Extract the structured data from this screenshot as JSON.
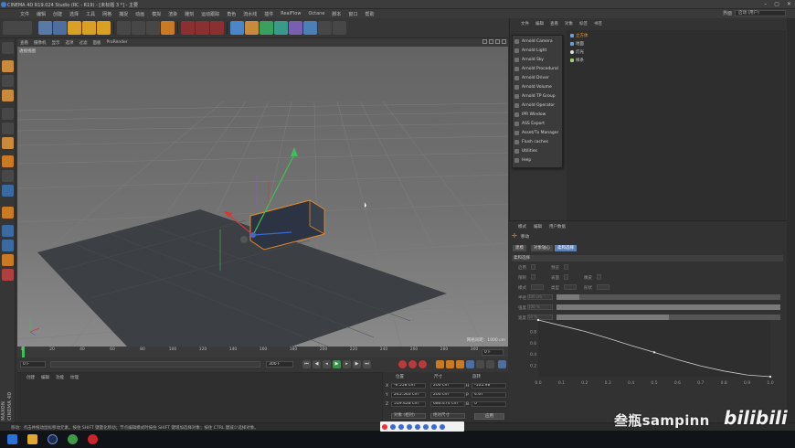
{
  "window": {
    "title": "CINEMA 4D R19.024 Studio (RC - R19) - [未标题 3 *] - 主要"
  },
  "menu": [
    "文件",
    "编辑",
    "创建",
    "选择",
    "工具",
    "网格",
    "捕捉",
    "动画",
    "模拟",
    "渲染",
    "雕刻",
    "运动跟踪",
    "角色",
    "流水线",
    "插件",
    "RealFlow",
    "Octane",
    "脚本",
    "窗口",
    "帮助"
  ],
  "layout": {
    "label": "界面",
    "value": "启动 (用户)"
  },
  "viewport": {
    "menu": [
      "查看",
      "摄像机",
      "显示",
      "选项",
      "过滤",
      "面板",
      "ProRender"
    ],
    "label": "透视视图",
    "grid_spacing": "网格间距：1000 cm"
  },
  "timeline": {
    "ticks": [
      "0",
      "20",
      "40",
      "60",
      "80",
      "100",
      "120",
      "140",
      "160",
      "180",
      "200",
      "220",
      "240",
      "260",
      "280",
      "300"
    ],
    "current_frame": "0 F",
    "start_frame": "0 F",
    "end_frame": "300 F",
    "min_frame": "0 F",
    "max_frame": "300 F"
  },
  "material_panel": {
    "menu": [
      "创建",
      "编辑",
      "功能",
      "纹理"
    ]
  },
  "coordinates": {
    "headers": [
      "位置",
      "尺寸",
      "旋转"
    ],
    "rows": [
      {
        "axis": "X",
        "pos": "-6.558 cm",
        "size": "200 cm",
        "rot_axis": "H",
        "rot": "-105.98 °"
      },
      {
        "axis": "Y",
        "pos": "245.563 cm",
        "size": "200 cm",
        "rot_axis": "P",
        "rot": "4.67 °"
      },
      {
        "axis": "Z",
        "pos": "519.428 cm",
        "size": "686.474 cm",
        "rot_axis": "B",
        "rot": "0 °"
      }
    ],
    "mode_select": "对象 (相对)",
    "size_select": "绝对尺寸",
    "apply_label": "应用"
  },
  "object_manager": {
    "tabs": [
      "文件",
      "编辑",
      "查看",
      "对象",
      "标签",
      "书签"
    ],
    "objects": [
      {
        "name": "立方体",
        "selected": true
      },
      {
        "name": "地面",
        "selected": false
      },
      {
        "name": "灯光",
        "selected": false
      },
      {
        "name": "样条",
        "selected": false
      }
    ]
  },
  "arnold_menu": {
    "items": [
      "Arnold Camera",
      "Arnold Light",
      "Arnold Sky",
      "Arnold Procedural",
      "Arnold Driver",
      "Arnold Volume",
      "Arnold TP Group",
      "Arnold Operator",
      "IPR Window",
      "ASS Export",
      "Asset/Tx Manager",
      "Flush caches",
      "Utilities",
      "Help"
    ]
  },
  "attributes": {
    "tabs": [
      "模式",
      "编辑",
      "用户数据"
    ],
    "object_name": "移动",
    "sub_tabs": [
      "建模",
      "对象轴心",
      "柔和选择"
    ],
    "section": "柔和选择",
    "props": [
      {
        "label": "启用",
        "value": "",
        "row": 0,
        "col": 0
      },
      {
        "label": "限制",
        "value": "",
        "row": 1,
        "col": 0
      },
      {
        "label": "模式",
        "value": "",
        "row": 2,
        "col": 0
      },
      {
        "label": "半径",
        "value": "100 cm",
        "row": 3,
        "col": 0
      },
      {
        "label": "强度",
        "value": "100 %",
        "row": 4,
        "col": 0
      },
      {
        "label": "宽度",
        "value": "50 %",
        "row": 5,
        "col": 0
      },
      {
        "label": "预览",
        "value": "",
        "row": 0,
        "col": 1
      },
      {
        "label": "表面",
        "value": "",
        "row": 1,
        "col": 1
      },
      {
        "label": "类型",
        "value": "",
        "row": 2,
        "col": 1
      },
      {
        "label": "橡皮",
        "value": "",
        "row": 1,
        "col": 2
      },
      {
        "label": "形状",
        "value": "",
        "row": 2,
        "col": 2
      }
    ],
    "sliders": [
      {
        "row": 3,
        "fraction": 0.1
      },
      {
        "row": 4,
        "fraction": 1.0
      },
      {
        "row": 5,
        "fraction": 0.5
      }
    ],
    "graph": {
      "y_ticks": [
        "0.8",
        "0.6",
        "0.4",
        "0.2"
      ],
      "x_ticks": [
        "0.0",
        "0.1",
        "0.2",
        "0.3",
        "0.4",
        "0.5",
        "0.6",
        "0.7",
        "0.8",
        "0.9",
        "1.0"
      ],
      "curve": [
        [
          0,
          1.0
        ],
        [
          0.1,
          0.9
        ],
        [
          0.2,
          0.8
        ],
        [
          0.3,
          0.68
        ],
        [
          0.4,
          0.55
        ],
        [
          0.5,
          0.43
        ],
        [
          0.6,
          0.3
        ],
        [
          0.7,
          0.19
        ],
        [
          0.8,
          0.1
        ],
        [
          0.9,
          0.03
        ],
        [
          1.0,
          0
        ]
      ]
    }
  },
  "status": {
    "text": "移动：点击并拖动鼠标移动元素。按住 SHIFT 键量化移动；节点编辑模式时按住 SHIFT 键增加选择对象；按住 CTRL 键减少选择对象。"
  },
  "watermark": {
    "uploader": "叁瓶sampinn",
    "brand": "bilibili"
  },
  "colors": {
    "accent": "#ff9c2a",
    "selection_blue": "#5d7eb3",
    "play_green": "#3fbf57",
    "record_red": "#b93a3a"
  }
}
